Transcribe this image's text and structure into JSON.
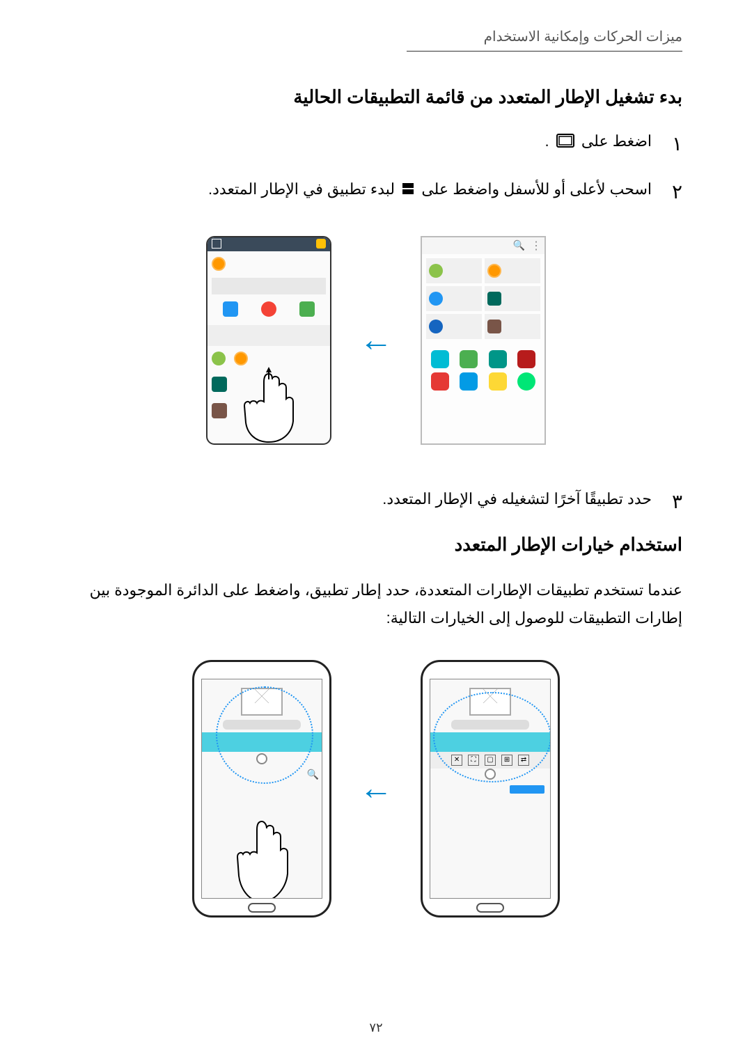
{
  "header": "ميزات الحركات وإمكانية الاستخدام",
  "section1_title": "بدء تشغيل الإطار المتعدد من قائمة التطبيقات الحالية",
  "step1_num": "١",
  "step1_text_a": "اضغط على",
  "step1_text_b": ".",
  "step2_num": "٢",
  "step2_text_a": "اسحب لأعلى أو للأسفل واضغط على",
  "step2_text_b": "لبدء تطبيق في الإطار المتعدد.",
  "step3_num": "٣",
  "step3_text": "حدد تطبيقًا آخرًا لتشغيله في الإطار المتعدد.",
  "section2_title": "استخدام خيارات الإطار المتعدد",
  "body2": "عندما تستخدم تطبيقات الإطارات المتعددة، حدد إطار تطبيق، واضغط على الدائرة الموجودة بين إطارات التطبيقات للوصول إلى الخيارات التالية:",
  "page_number": "٧٢"
}
